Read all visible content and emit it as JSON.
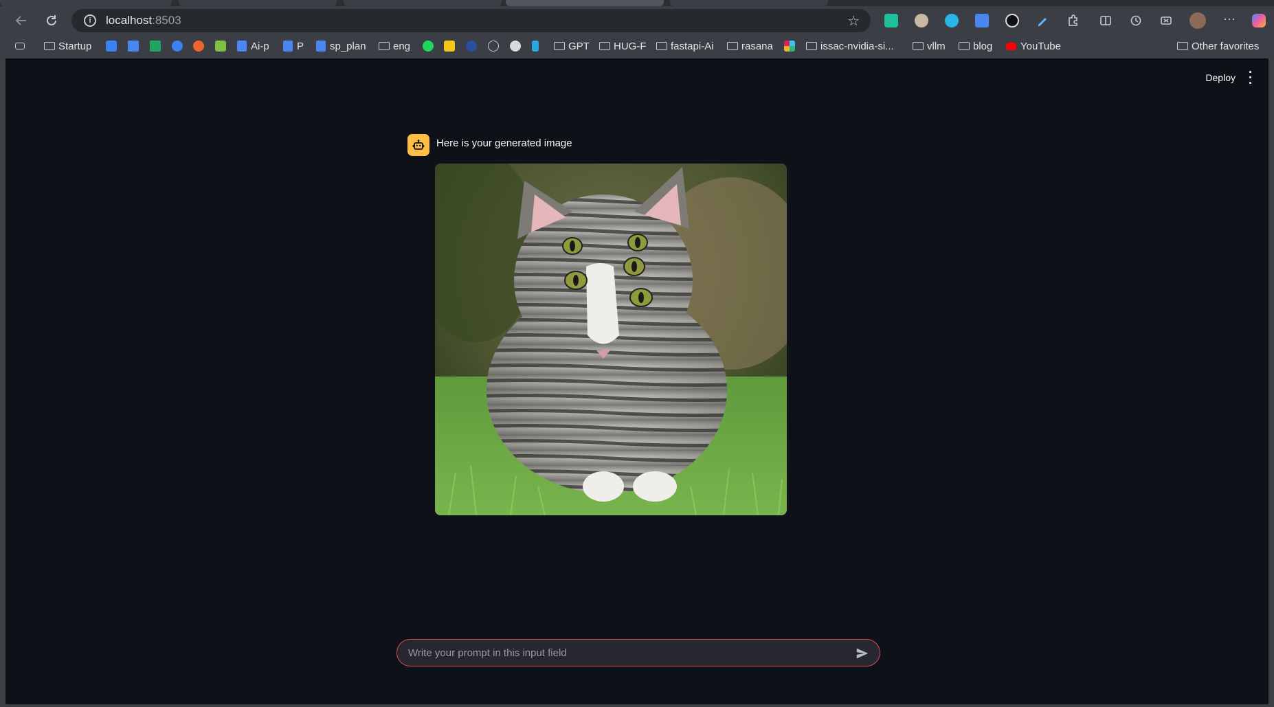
{
  "browser": {
    "url_host": "localhost",
    "url_port": ":8503",
    "bookmarks": [
      {
        "label": "Startup",
        "kind": "folder"
      },
      {
        "label": "Ai-p",
        "kind": "doc"
      },
      {
        "label": "P",
        "kind": "doc"
      },
      {
        "label": "sp_plan",
        "kind": "doc"
      },
      {
        "label": "eng",
        "kind": "folder"
      },
      {
        "label": "GPT",
        "kind": "folder"
      },
      {
        "label": "HUG-F",
        "kind": "folder"
      },
      {
        "label": "fastapi-Ai",
        "kind": "folder"
      },
      {
        "label": "rasana",
        "kind": "folder"
      },
      {
        "label": "issac-nvidia-si...",
        "kind": "folder"
      },
      {
        "label": "vllm",
        "kind": "folder"
      },
      {
        "label": "blog",
        "kind": "folder"
      },
      {
        "label": "YouTube",
        "kind": "youtube"
      },
      {
        "label": "Other favorites",
        "kind": "folder"
      }
    ]
  },
  "app": {
    "deploy_label": "Deploy",
    "assistant_message": "Here is your generated image",
    "input_placeholder": "Write your prompt in this input field"
  },
  "icons": {
    "back": "arrow-left-icon",
    "reload": "reload-icon",
    "info": "info-icon",
    "star": "star-icon",
    "menu": "more-vertical-icon",
    "avatar": "robot-icon",
    "send": "send-icon"
  },
  "colors": {
    "app_background": "#0e1117",
    "avatar_bg": "#ffbd45",
    "input_border": "#e0484f",
    "input_bg": "#262730"
  }
}
